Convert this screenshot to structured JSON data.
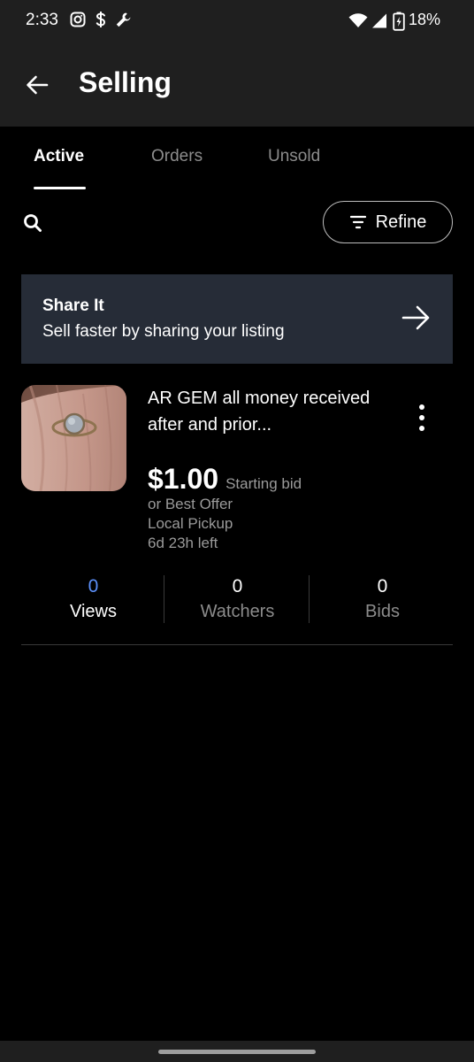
{
  "status_bar": {
    "time": "2:33",
    "battery": "18%"
  },
  "header": {
    "title": "Selling"
  },
  "tabs": [
    {
      "label": "Active",
      "selected": true
    },
    {
      "label": "Orders",
      "selected": false
    },
    {
      "label": "Unsold",
      "selected": false
    }
  ],
  "toolbar": {
    "search_icon": "search-icon",
    "refine_label": "Refine"
  },
  "share_card": {
    "title": "Share It",
    "subtitle": "Sell faster by sharing your listing"
  },
  "listing": {
    "title": "AR GEM all money received after and prior...",
    "price": "$1.00",
    "price_note": "Starting bid",
    "best_offer": "or Best Offer",
    "pickup": "Local Pickup",
    "time_left": "6d 23h left"
  },
  "stats": [
    {
      "value": "0",
      "label": "Views"
    },
    {
      "value": "0",
      "label": "Watchers"
    },
    {
      "value": "0",
      "label": "Bids"
    }
  ],
  "colors": {
    "accent_blue": "#5b8ff9",
    "share_card_bg": "#262c37",
    "app_bar_bg": "#1f1f1f"
  }
}
